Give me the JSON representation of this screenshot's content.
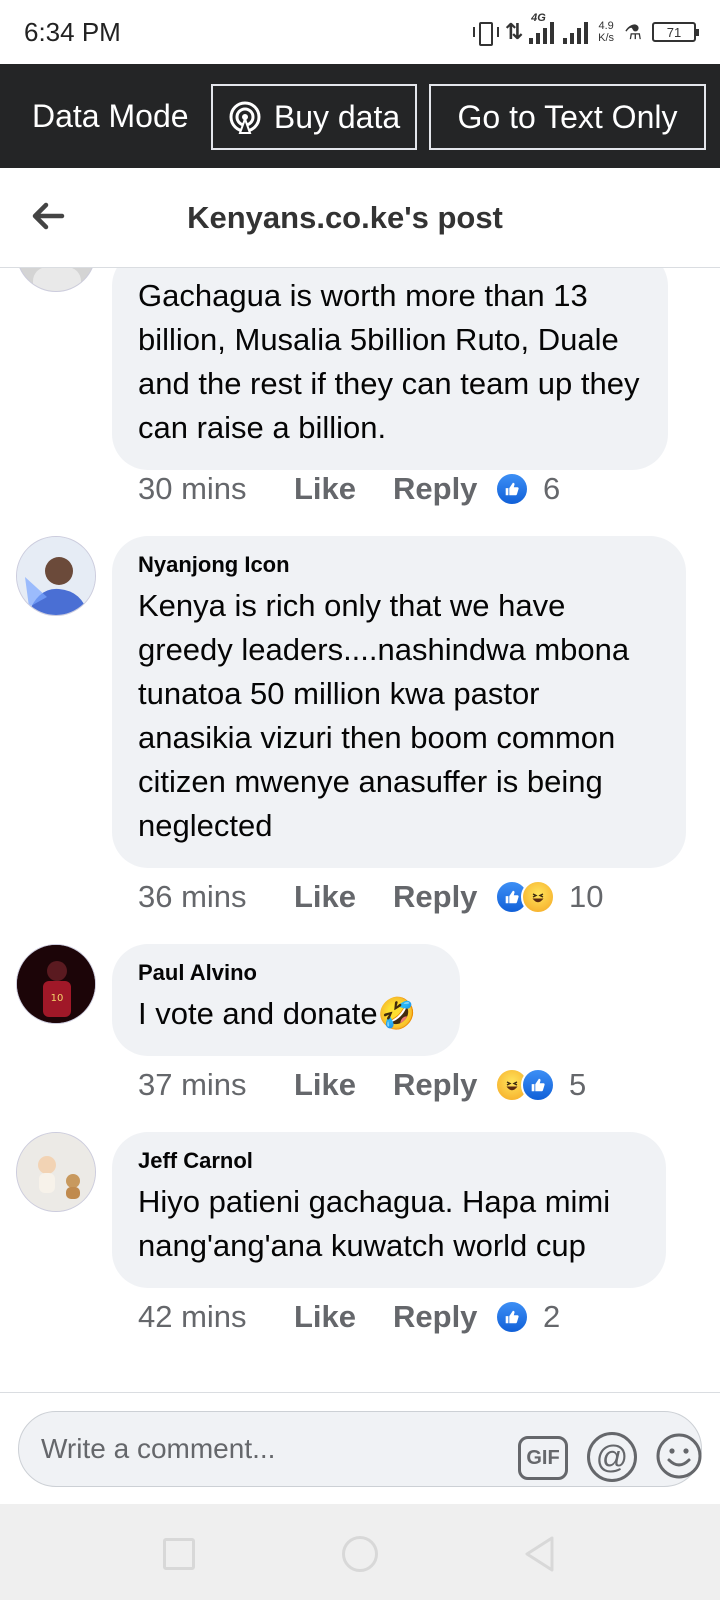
{
  "status_bar": {
    "time": "6:34 PM",
    "network": "4G",
    "speed": "4.9",
    "speed_unit": "K/s",
    "battery": "71"
  },
  "data_bar": {
    "label": "Data Mode",
    "buy_data": "Buy data",
    "text_only": "Go to Text Only"
  },
  "header": {
    "title": "Kenyans.co.ke's post",
    "back_icon": "arrow-left-icon"
  },
  "comments": [
    {
      "name": "",
      "text": "Gachagua is worth more than 13 billion, Musalia 5billion Ruto, Duale and the rest if they can team up they can raise a billion.",
      "time": "30 mins",
      "like": "Like",
      "reply": "Reply",
      "reactions": [
        "like"
      ],
      "count": "6"
    },
    {
      "name": "Nyanjong Icon",
      "text": "Kenya is rich only that we have greedy leaders....nashindwa mbona tunatoa 50 million kwa pastor anasikia vizuri then boom common citizen mwenye anasuffer is being neglected",
      "time": "36 mins",
      "like": "Like",
      "reply": "Reply",
      "reactions": [
        "like",
        "haha"
      ],
      "count": "10"
    },
    {
      "name": "Paul Alvino",
      "text": "I vote and donate🤣",
      "time": "37 mins",
      "like": "Like",
      "reply": "Reply",
      "reactions": [
        "haha",
        "like"
      ],
      "count": "5"
    },
    {
      "name": "Jeff Carnol",
      "text": "Hiyo patieni gachagua. Hapa mimi nang'ang'ana kuwatch world cup",
      "time": "42 mins",
      "like": "Like",
      "reply": "Reply",
      "reactions": [
        "like"
      ],
      "count": "2"
    }
  ],
  "composer": {
    "placeholder": "Write a comment...",
    "gif_label": "GIF",
    "at_label": "@"
  },
  "colors": {
    "data_bar": "#242526",
    "bubble": "#f0f2f5",
    "like_blue": "#1877f2",
    "meta_grey": "#65676b"
  }
}
